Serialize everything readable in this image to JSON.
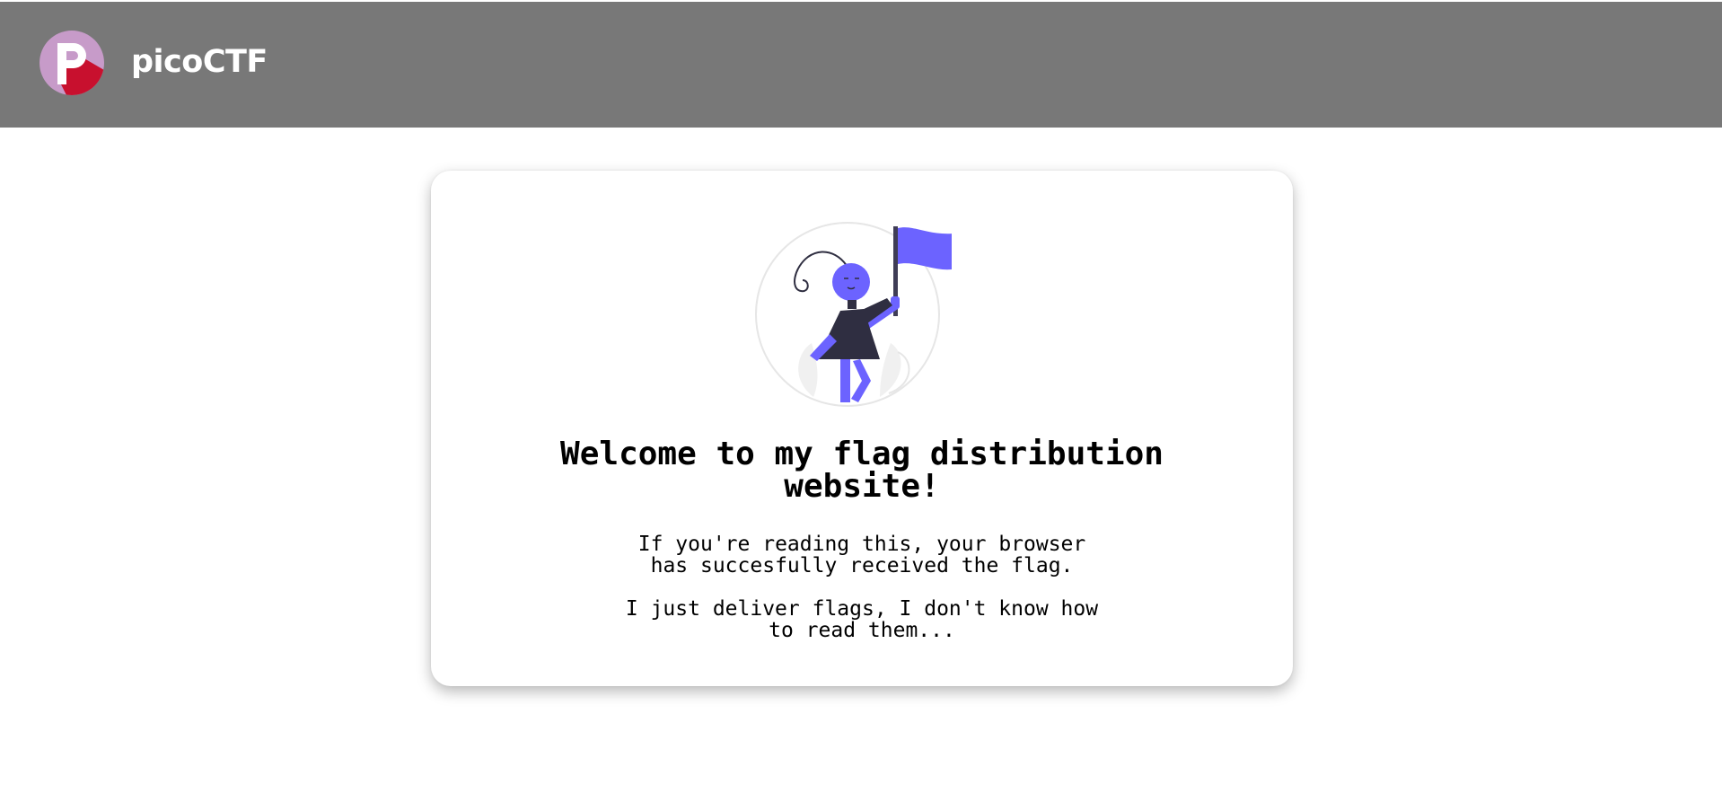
{
  "header": {
    "brand": "picoCTF",
    "logo_letter": "p",
    "background_color": "#787878",
    "logo_colors": {
      "light": "#c79bc9",
      "dark": "#c8102e"
    }
  },
  "card": {
    "title_line1": "Welcome to my flag distribution",
    "title_line2": "website!",
    "paragraph1_line1": "If you're reading this, your browser",
    "paragraph1_line2": "has succesfully received the flag.",
    "paragraph2_line1": "I just deliver flags, I don't know how",
    "paragraph2_line2": "to read them...",
    "illustration": "woman-holding-flag-illustration",
    "accent_color": "#6c63ff"
  }
}
